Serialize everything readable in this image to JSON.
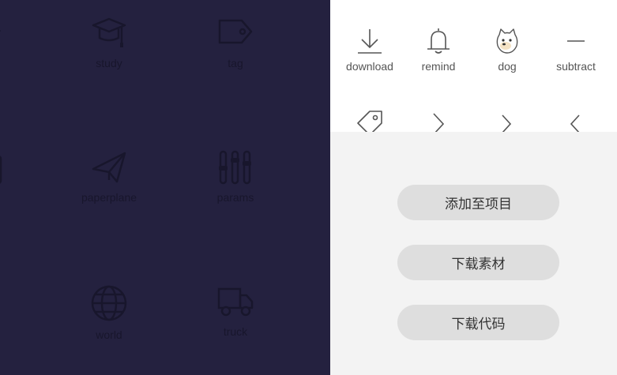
{
  "left_panel": {
    "background": "#24213f",
    "icons": [
      {
        "icon": "graduation-cap-icon",
        "label": "study"
      },
      {
        "icon": "tag-icon",
        "label": "tag"
      },
      {
        "icon": "paperplane-icon",
        "label": "paperplane"
      },
      {
        "icon": "params-icon",
        "label": "params"
      },
      {
        "icon": "world-icon",
        "label": "world"
      },
      {
        "icon": "truck-icon",
        "label": "truck"
      }
    ]
  },
  "icon_grid": {
    "items": [
      {
        "icon": "download-icon",
        "label": "download"
      },
      {
        "icon": "bell-icon",
        "label": "remind"
      },
      {
        "icon": "dog-icon",
        "label": "dog"
      },
      {
        "icon": "minus-icon",
        "label": "subtract"
      }
    ],
    "second_row": [
      "tag-icon",
      "chevron-right-icon",
      "chevron-right-icon",
      "chevron-left-icon"
    ]
  },
  "actions": {
    "add_to_project": "添加至项目",
    "download_asset": "下载素材",
    "download_code": "下载代码"
  }
}
